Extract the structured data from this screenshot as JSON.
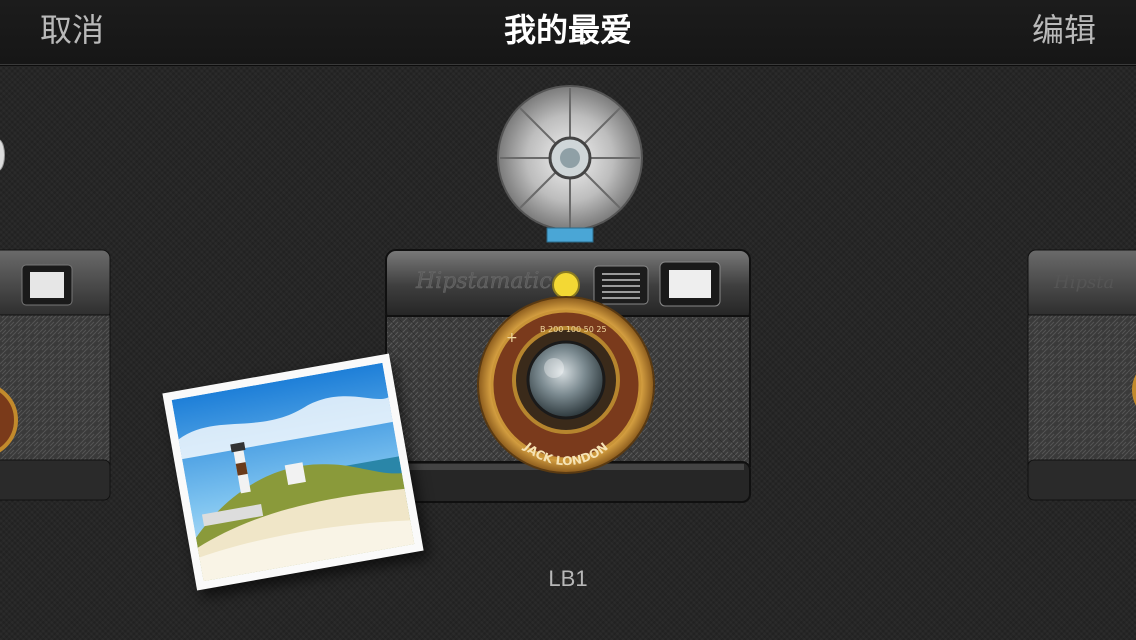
{
  "navbar": {
    "cancel_label": "取消",
    "title": "我的最爱",
    "edit_label": "编辑"
  },
  "camera": {
    "brand_script": "Hipstamatic",
    "lens_name": "JACK LONDON",
    "shutter_scale": "B 200 100 50 25",
    "name": "LB1"
  }
}
